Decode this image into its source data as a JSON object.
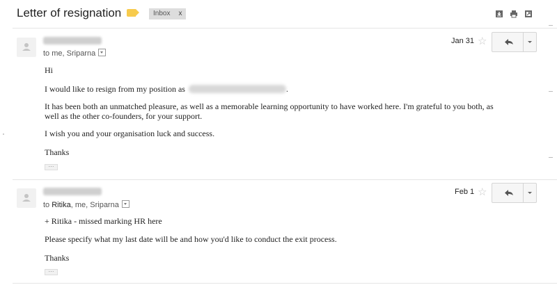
{
  "thread": {
    "subject": "Letter of resignation",
    "label_chip": "Inbox",
    "label_remove": "x",
    "label_color": "#f7cb4d",
    "header_icons": [
      "download-icon",
      "print-icon",
      "new-window-icon"
    ]
  },
  "messages": [
    {
      "to_prefix": "to ",
      "to_emph": "",
      "to_rest": "me, Sriparna",
      "date": "Jan 31",
      "starred": false,
      "body": {
        "greeting": "Hi",
        "line1": "I would like to resign from my position as",
        "line1_end": ".",
        "line2a": "It has been both an unmatched pleasure, as well as a memorable learning opportunity to have worked here. I'm grateful to you both, as",
        "line2b": "well as the other co-founders, for your support.",
        "line3": "I wish you and your organisation luck and success.",
        "signoff": "Thanks"
      },
      "ellipsis": "···"
    },
    {
      "to_prefix": "to ",
      "to_emph": "Ritika",
      "to_rest": ", me, Sriparna",
      "date": "Feb 1",
      "starred": false,
      "body": {
        "line1": "+ Ritika - missed marking HR here",
        "line2": "Please specify what my last date will be and how you'd like to conduct the exit process.",
        "signoff": "Thanks"
      },
      "ellipsis": "···"
    }
  ]
}
